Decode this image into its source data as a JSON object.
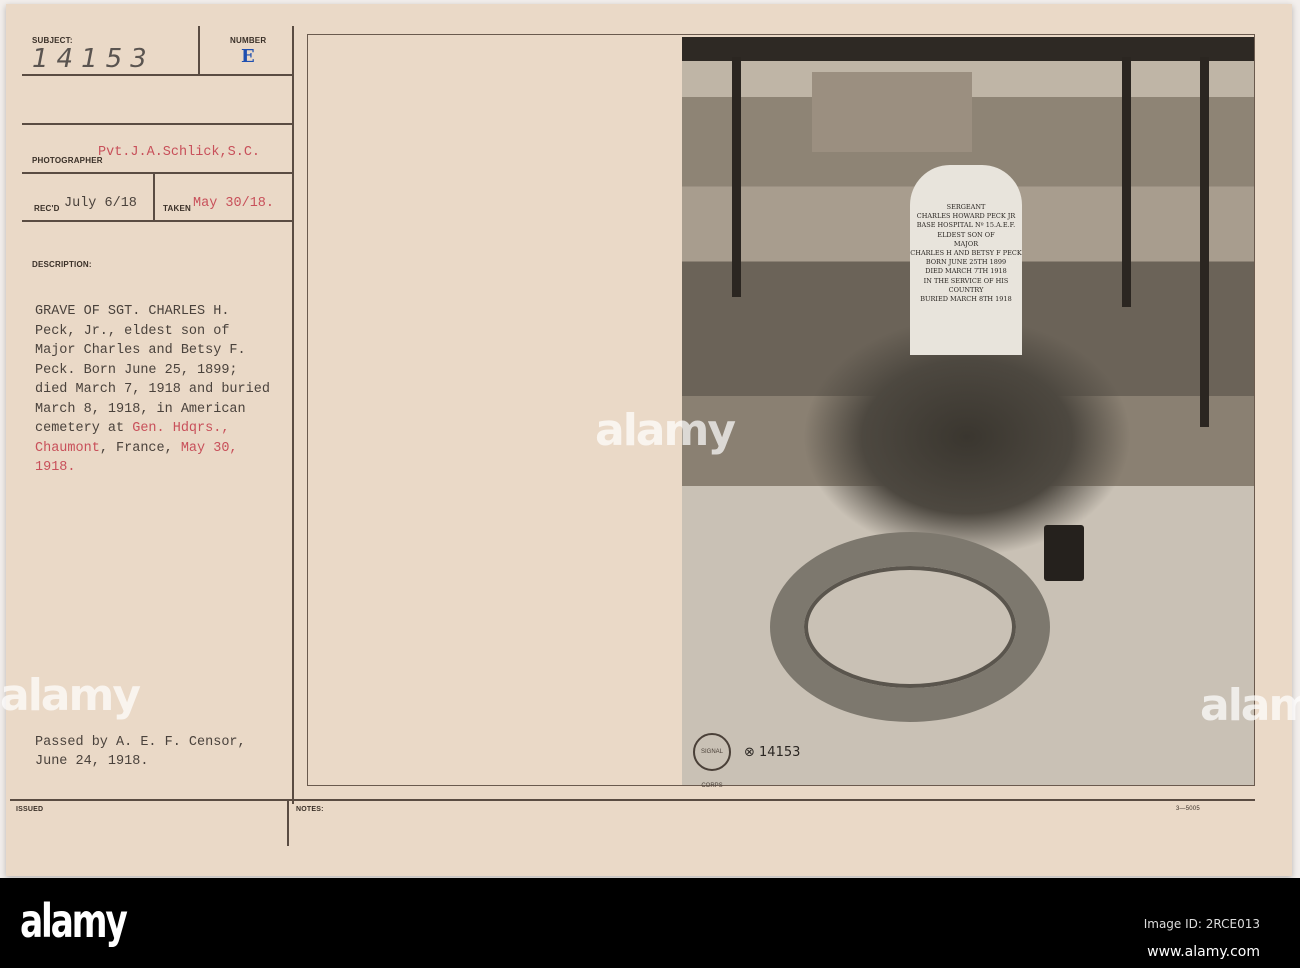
{
  "card": {
    "subject_label": "SUBJECT:",
    "number_label": "NUMBER",
    "subject_number": "14153",
    "number_stamp": "E",
    "photographer_label": "PHOTOGRAPHER",
    "photographer": "Pvt.J.A.Schlick,S.C.",
    "recd_label": "REC'D",
    "recd": "July 6/18",
    "taken_label": "TAKEN",
    "taken": "May 30/18.",
    "description_label": "DESCRIPTION:",
    "description_lines": [
      "GRAVE OF SGT. CHARLES H.",
      "Peck, Jr., eldest son of",
      "Major Charles and Betsy F.",
      "Peck. Born June 25, 1899;",
      "died March 7, 1918 and buried",
      "March 8, 1918, in American",
      "cemetery at "
    ],
    "description_red": [
      "Gen. Hdqrs.,",
      "Chaumont"
    ],
    "description_after": [
      ", France, ",
      "May 30,",
      "1918."
    ],
    "censor_lines": [
      "Passed by A. E. F. Censor,",
      "June 24, 1918."
    ],
    "issued_label": "ISSUED",
    "notes_label": "NOTES:",
    "form_number": "3—5005"
  },
  "photo": {
    "headstone_lines": [
      "SERGEANT",
      "CHARLES HOWARD PECK JR",
      "BASE HOSPITAL Nº 15.A.E.F.",
      "ELDEST SON OF",
      "MAJOR",
      "CHARLES H AND BETSY F PECK",
      "BORN JUNE 25TH 1899",
      "DIED MARCH 7TH 1918",
      "IN THE SERVICE OF HIS COUNTRY",
      "BURIED MARCH 8TH 1918"
    ],
    "negative_number": "⊗ 14153",
    "seal_text": "SIGNAL CORPS"
  },
  "watermark": {
    "text": "alamy"
  },
  "footer": {
    "logo": "alamy",
    "image_id": "Image ID: 2RCE013",
    "url": "www.alamy.com"
  }
}
